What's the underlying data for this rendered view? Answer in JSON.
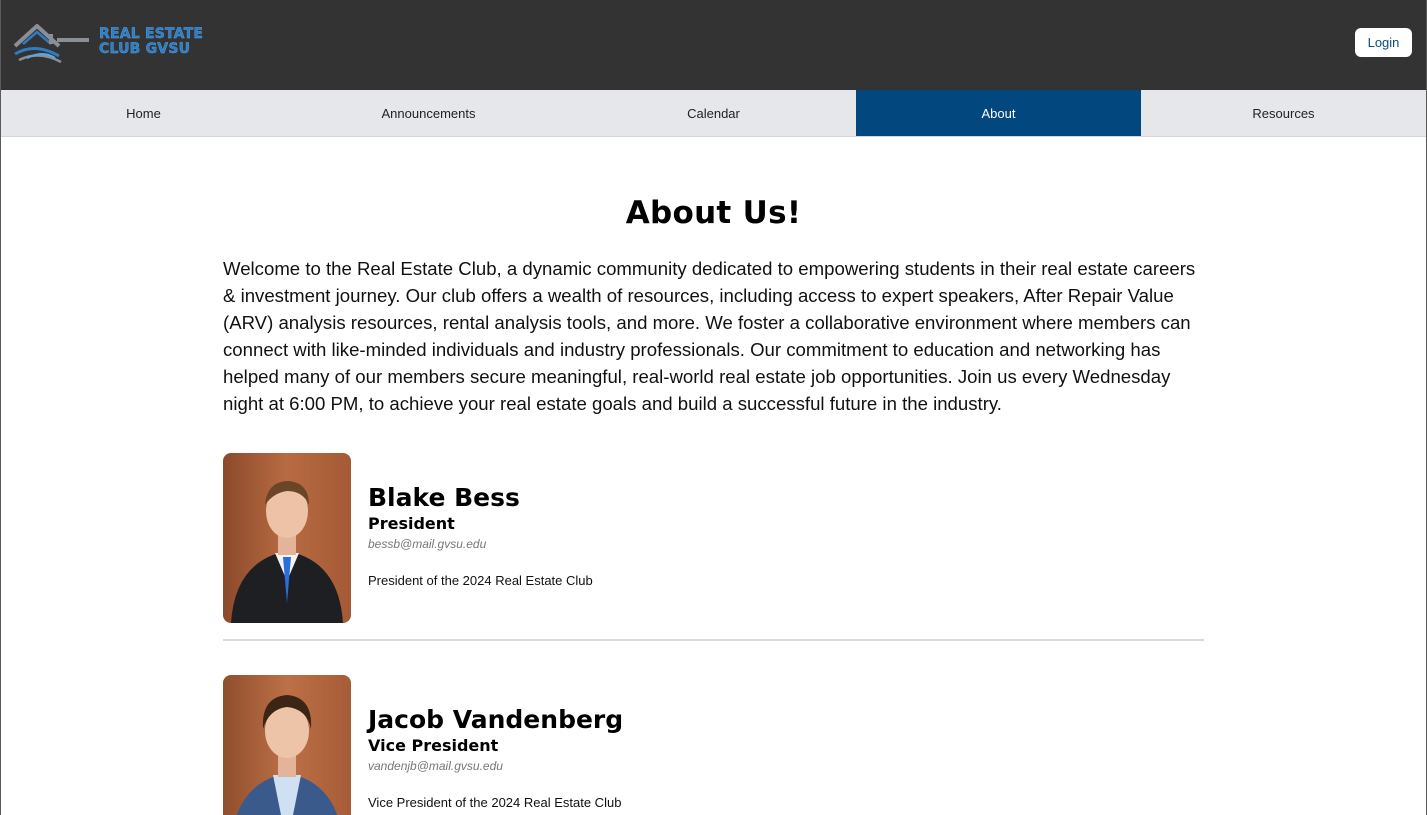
{
  "header": {
    "logo_line1": "REAL ESTATE",
    "logo_line2": "CLUB GVSU",
    "login_label": "Login"
  },
  "nav": {
    "items": [
      {
        "label": "Home"
      },
      {
        "label": "Announcements"
      },
      {
        "label": "Calendar"
      },
      {
        "label": "About",
        "active": true
      },
      {
        "label": "Resources"
      }
    ]
  },
  "main": {
    "title": "About Us!",
    "intro": "Welcome to the Real Estate Club, a dynamic community dedicated to empowering students in their real estate careers & investment journey. Our club offers a wealth of resources, including access to expert speakers, After Repair Value (ARV) analysis resources, rental analysis tools, and more. We foster a collaborative environment where members can connect with like-minded individuals and industry professionals. Our commitment to education and networking has helped many of our members secure meaningful, real-world real estate job opportunities. Join us every Wednesday night at 6:00 PM, to achieve your real estate goals and build a successful future in the industry.",
    "members": [
      {
        "name": "Blake Bess",
        "role": "President",
        "email": "bessb@mail.gvsu.edu",
        "description": "President of the 2024 Real Estate Club"
      },
      {
        "name": "Jacob Vandenberg",
        "role": "Vice President",
        "email": "vandenjb@mail.gvsu.edu",
        "description": "Vice President of the 2024 Real Estate Club"
      }
    ]
  },
  "colors": {
    "header_bg": "#333333",
    "nav_bg": "#e6e7ea",
    "nav_active": "#02477e",
    "logo_blue": "#2d7cc4"
  }
}
